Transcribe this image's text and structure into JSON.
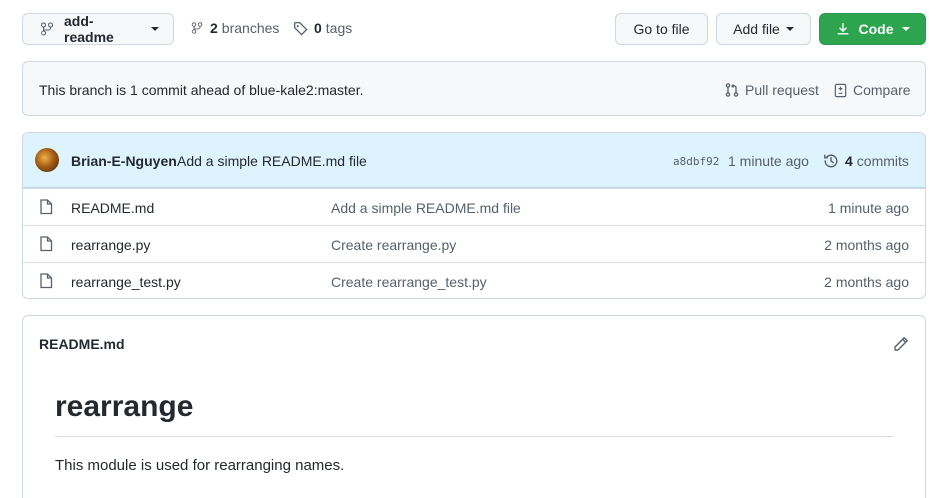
{
  "toolbar": {
    "branch_label": "add-readme",
    "branches_count": "2",
    "branches_label": "branches",
    "tags_count": "0",
    "tags_label": "tags",
    "goto_label": "Go to file",
    "addfile_label": "Add file",
    "code_label": "Code"
  },
  "banner": {
    "text": "This branch is 1 commit ahead of blue-kale2:master.",
    "pull_request_label": "Pull request",
    "compare_label": "Compare"
  },
  "latest_commit": {
    "author": "Brian-E-Nguyen",
    "message": "Add a simple README.md file",
    "sha": "a8dbf92",
    "time": "1 minute ago",
    "commits_count": "4",
    "commits_label": "commits"
  },
  "files": [
    {
      "name": "README.md",
      "message": "Add a simple README.md file",
      "age": "1 minute ago"
    },
    {
      "name": "rearrange.py",
      "message": "Create rearrange.py",
      "age": "2 months ago"
    },
    {
      "name": "rearrange_test.py",
      "message": "Create rearrange_test.py",
      "age": "2 months ago"
    }
  ],
  "readme": {
    "header": "README.md",
    "title": "rearrange",
    "body": "This module is used for rearranging names."
  },
  "colors": {
    "accent_green": "#2da44e",
    "commit_bar": "#ddf4ff",
    "muted_text": "#57606a"
  }
}
